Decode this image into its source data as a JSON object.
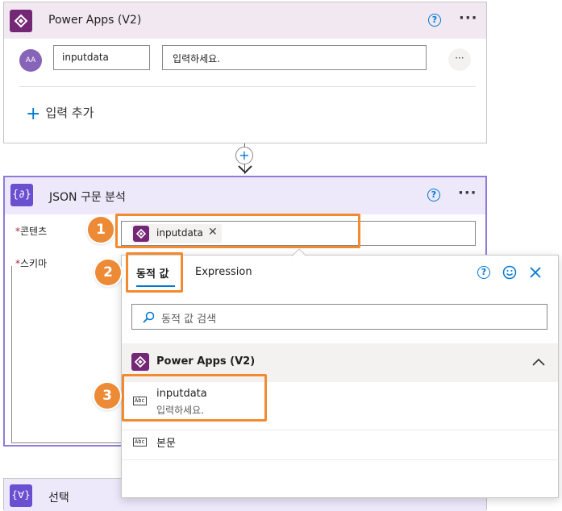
{
  "powerapps_card": {
    "title": "Power Apps (V2)",
    "input_name": "inputdata",
    "input_placeholder": "입력하세요.",
    "avatar_text": "AA",
    "add_input_label": "입력 추가"
  },
  "json_card": {
    "title": "JSON 구문 분석",
    "content_label": "콘텐츠",
    "schema_label": "스키마",
    "required_mark": "*",
    "token_label": "inputdata"
  },
  "dynamic_panel": {
    "tab_dynamic": "동적 값",
    "tab_expression": "Expression",
    "search_placeholder": "동적 값 검색",
    "section_title": "Power Apps (V2)",
    "items": [
      {
        "name": "inputdata",
        "desc": "입력하세요.",
        "icon": "Abc"
      },
      {
        "name": "본문",
        "desc": "",
        "icon": "Abc"
      }
    ]
  },
  "select_card": {
    "title": "선택"
  },
  "callouts": [
    "1",
    "2",
    "3"
  ],
  "colors": {
    "powerapps_header": "#f1e8f1",
    "json_header": "#ede9fb",
    "accent": "#0078d4",
    "purple": "#742774",
    "json_icon": "#6b4fd1",
    "orange": "#f28a30"
  }
}
